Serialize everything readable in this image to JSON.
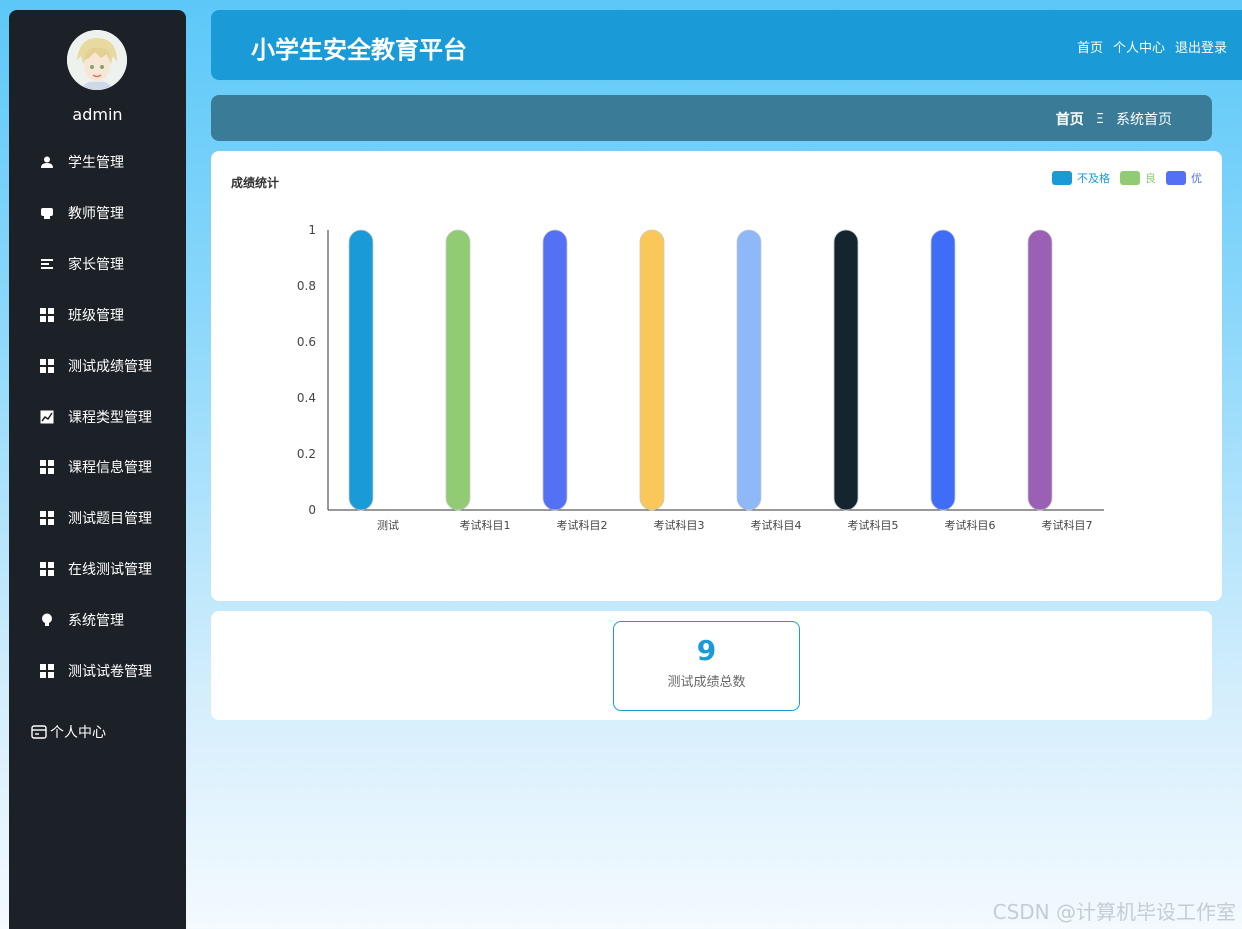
{
  "sidebar": {
    "username": "admin",
    "items": [
      {
        "label": "学生管理",
        "icon": "user-icon"
      },
      {
        "label": "教师管理",
        "icon": "inbox-icon"
      },
      {
        "label": "家长管理",
        "icon": "list-icon"
      },
      {
        "label": "班级管理",
        "icon": "grid-icon"
      },
      {
        "label": "测试成绩管理",
        "icon": "grid-icon"
      },
      {
        "label": "课程类型管理",
        "icon": "chart-icon"
      },
      {
        "label": "课程信息管理",
        "icon": "grid-icon"
      },
      {
        "label": "测试题目管理",
        "icon": "grid-icon"
      },
      {
        "label": "在线测试管理",
        "icon": "grid-icon"
      },
      {
        "label": "系统管理",
        "icon": "bulb-icon"
      },
      {
        "label": "测试试卷管理",
        "icon": "grid-icon"
      }
    ],
    "personal": {
      "label": "个人中心",
      "icon": "card-icon"
    }
  },
  "header": {
    "title": "小学生安全教育平台",
    "links": {
      "home": "首页",
      "personal": "个人中心",
      "logout": "退出登录"
    }
  },
  "breadcrumb": {
    "home": "首页",
    "separator": "Ξ",
    "current": "系统首页"
  },
  "chart_data": {
    "type": "bar",
    "title": "成绩统计",
    "categories": [
      "测试",
      "考试科目1",
      "考试科目2",
      "考试科目3",
      "考试科目4",
      "考试科目5",
      "考试科目6",
      "考试科目7"
    ],
    "values": [
      1,
      1,
      1,
      1,
      1,
      1,
      1,
      1
    ],
    "bar_colors": [
      "#1a9bd7",
      "#91cc75",
      "#5470f5",
      "#fac858",
      "#8fb8f8",
      "#14252f",
      "#3f6df8",
      "#9a60b4"
    ],
    "legend": [
      {
        "label": "不及格",
        "color": "#1a9bd7"
      },
      {
        "label": "良",
        "color": "#91cc75"
      },
      {
        "label": "优",
        "color": "#5470f5"
      }
    ],
    "legend_position": "top-right",
    "yticks": [
      "0",
      "0.2",
      "0.4",
      "0.6",
      "0.8",
      "1"
    ],
    "ylim": [
      0,
      1
    ],
    "grid": false
  },
  "stats": {
    "value": "9",
    "label": "测试成绩总数"
  },
  "watermark": "CSDN @计算机毕设工作室"
}
